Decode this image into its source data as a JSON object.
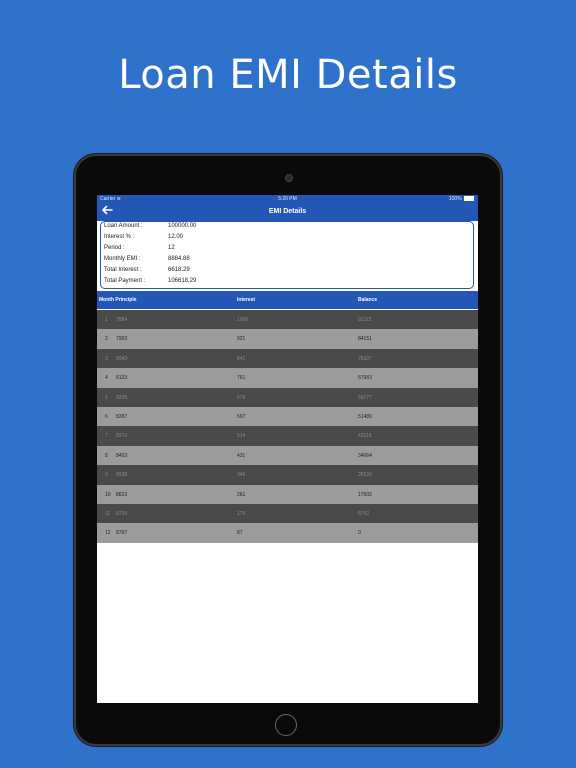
{
  "headline": "Loan EMI Details",
  "status_bar": {
    "carrier": "Carrier",
    "time": "5:20 PM",
    "battery": "100%"
  },
  "nav": {
    "title": "EMI Details",
    "back_icon": "arrow-left-icon"
  },
  "summary": [
    {
      "label": "Loan Amount :",
      "value": "100000.00"
    },
    {
      "label": "Interest % :",
      "value": "12.00"
    },
    {
      "label": "Period :",
      "value": "12"
    },
    {
      "label": "Monthly EMI :",
      "value": "8884.88"
    },
    {
      "label": "Total Interest :",
      "value": "6618.29"
    },
    {
      "label": "Total Payment :",
      "value": "106618.29"
    }
  ],
  "table": {
    "headers": {
      "month_principle": "Month Principle",
      "interest": "Interest",
      "balance": "Balance"
    },
    "rows": [
      {
        "month": "1",
        "principle": "7884",
        "interest": "1000",
        "balance": "92115"
      },
      {
        "month": "2",
        "principle": "7963",
        "interest": "921",
        "balance": "84151"
      },
      {
        "month": "3",
        "principle": "8043",
        "interest": "841",
        "balance": "76107"
      },
      {
        "month": "4",
        "principle": "8123",
        "interest": "761",
        "balance": "67983"
      },
      {
        "month": "5",
        "principle": "8205",
        "interest": "679",
        "balance": "59777"
      },
      {
        "month": "6",
        "principle": "8287",
        "interest": "597",
        "balance": "51489"
      },
      {
        "month": "7",
        "principle": "8370",
        "interest": "514",
        "balance": "43118"
      },
      {
        "month": "8",
        "principle": "8453",
        "interest": "431",
        "balance": "34664"
      },
      {
        "month": "9",
        "principle": "8538",
        "interest": "346",
        "balance": "26126"
      },
      {
        "month": "10",
        "principle": "8623",
        "interest": "261",
        "balance": "17502"
      },
      {
        "month": "11",
        "principle": "8709",
        "interest": "175",
        "balance": "8792"
      },
      {
        "month": "12",
        "principle": "8797",
        "interest": "87",
        "balance": "0"
      }
    ]
  },
  "colors": {
    "background": "#2f72cc",
    "nav_blue": "#2456b8",
    "row_dark": "#4a4a4a",
    "row_light": "#9b9b9b"
  }
}
